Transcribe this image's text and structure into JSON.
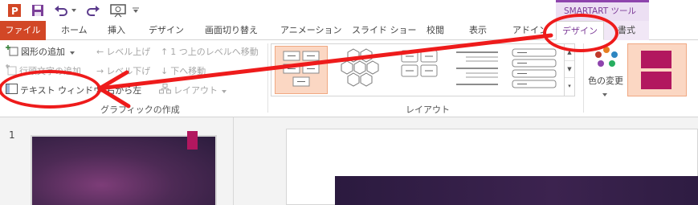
{
  "qat": {
    "icons": [
      "powerpoint-logo",
      "save-icon",
      "undo-icon",
      "redo-icon",
      "start-slideshow-icon",
      "customize-qat-icon"
    ]
  },
  "tabs": [
    "ファイル",
    "ホーム",
    "挿入",
    "デザイン",
    "画面切り替え",
    "アニメーション",
    "スライド ショー",
    "校閲",
    "表示",
    "アドイン",
    "デザイン",
    "書式"
  ],
  "contextual_header": "SMARTART ツール",
  "ribbon": {
    "create_graphic": {
      "add_shape": "図形の追加",
      "add_bullet": "行頭文字の追加",
      "text_pane": "テキスト ウィンドウ",
      "promote": "レベル上げ",
      "demote": "レベル下げ",
      "right_to_left": "右から左",
      "move_up": "1 つ上のレベルへ移動",
      "move_down": "下へ移動",
      "layout": "レイアウト",
      "group_label": "グラフィックの作成"
    },
    "layouts": {
      "group_label": "レイアウト"
    },
    "change_colors": "色の変更"
  },
  "slides": {
    "thumbnail_number": "1"
  },
  "colors": {
    "file_tab": "#d24726",
    "contextual_accent": "#7d3c98",
    "annotation_red": "#ee1b1b",
    "slide_mark": "#b2175f"
  }
}
